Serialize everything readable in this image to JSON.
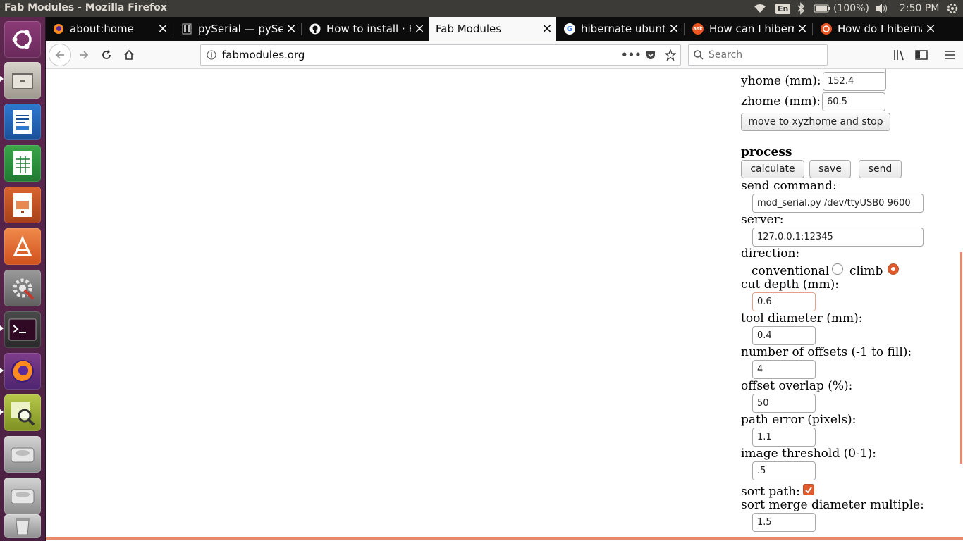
{
  "window": {
    "title": "Fab Modules - Mozilla Firefox"
  },
  "system_tray": {
    "keyboard_layout": "En",
    "battery": "(100%)",
    "clock": "2:50 PM",
    "icons": [
      "wifi-icon",
      "bluetooth-icon",
      "battery-icon",
      "volume-icon",
      "power-gear-icon"
    ]
  },
  "launcher": {
    "apps": [
      "ubuntu-dash",
      "files",
      "libreoffice-writer",
      "libreoffice-calc",
      "libreoffice-impress",
      "ubuntu-software",
      "system-settings",
      "terminal",
      "firefox",
      "image-viewer",
      "drive",
      "drive",
      "trash"
    ]
  },
  "tabs": [
    {
      "label": "about:home",
      "favicon": "firefox-icon",
      "active": false
    },
    {
      "label": "pySerial — pySeria",
      "favicon": "docs-icon",
      "active": false
    },
    {
      "label": "How to install · Fa",
      "favicon": "github-icon",
      "active": false
    },
    {
      "label": "Fab Modules",
      "favicon": "none",
      "active": true
    },
    {
      "label": "hibernate ubuntu",
      "favicon": "google-icon",
      "active": false
    },
    {
      "label": "How can I hiberna",
      "favicon": "askubuntu-icon",
      "active": false
    },
    {
      "label": "How do I hiberna",
      "favicon": "ubuntu-icon",
      "active": false
    }
  ],
  "navbar": {
    "url": "fabmodules.org",
    "search_placeholder": "Search"
  },
  "form": {
    "yhome_label": "yhome (mm):",
    "yhome_value": "152.4",
    "zhome_label": "zhome (mm):",
    "zhome_value": "60.5",
    "move_button": "move to xyzhome and stop",
    "process_heading": "process",
    "calculate_button": "calculate",
    "save_button": "save",
    "send_button": "send",
    "send_command_label": "send command:",
    "send_command_value": "mod_serial.py /dev/ttyUSB0 9600",
    "server_label": "server:",
    "server_value": "127.0.0.1:12345",
    "direction_label": "direction:",
    "conventional_label": "conventional",
    "climb_label": "climb",
    "direction_selected": "climb",
    "cut_depth_label": "cut depth (mm):",
    "cut_depth_value": "0.6",
    "tool_diameter_label": "tool diameter (mm):",
    "tool_diameter_value": "0.4",
    "offsets_label": "number of offsets (-1 to fill):",
    "offsets_value": "4",
    "overlap_label": "offset overlap (%):",
    "overlap_value": "50",
    "path_error_label": "path error (pixels):",
    "path_error_value": "1.1",
    "threshold_label": "image threshold (0-1):",
    "threshold_value": ".5",
    "sort_path_label": "sort path:",
    "sort_path_checked": true,
    "sort_merge_label": "sort merge diameter multiple:",
    "sort_merge_value": "1.5"
  },
  "colors": {
    "accent": "#e05a2b",
    "launcher": "#5e2750",
    "panel": "#3c3b37"
  }
}
